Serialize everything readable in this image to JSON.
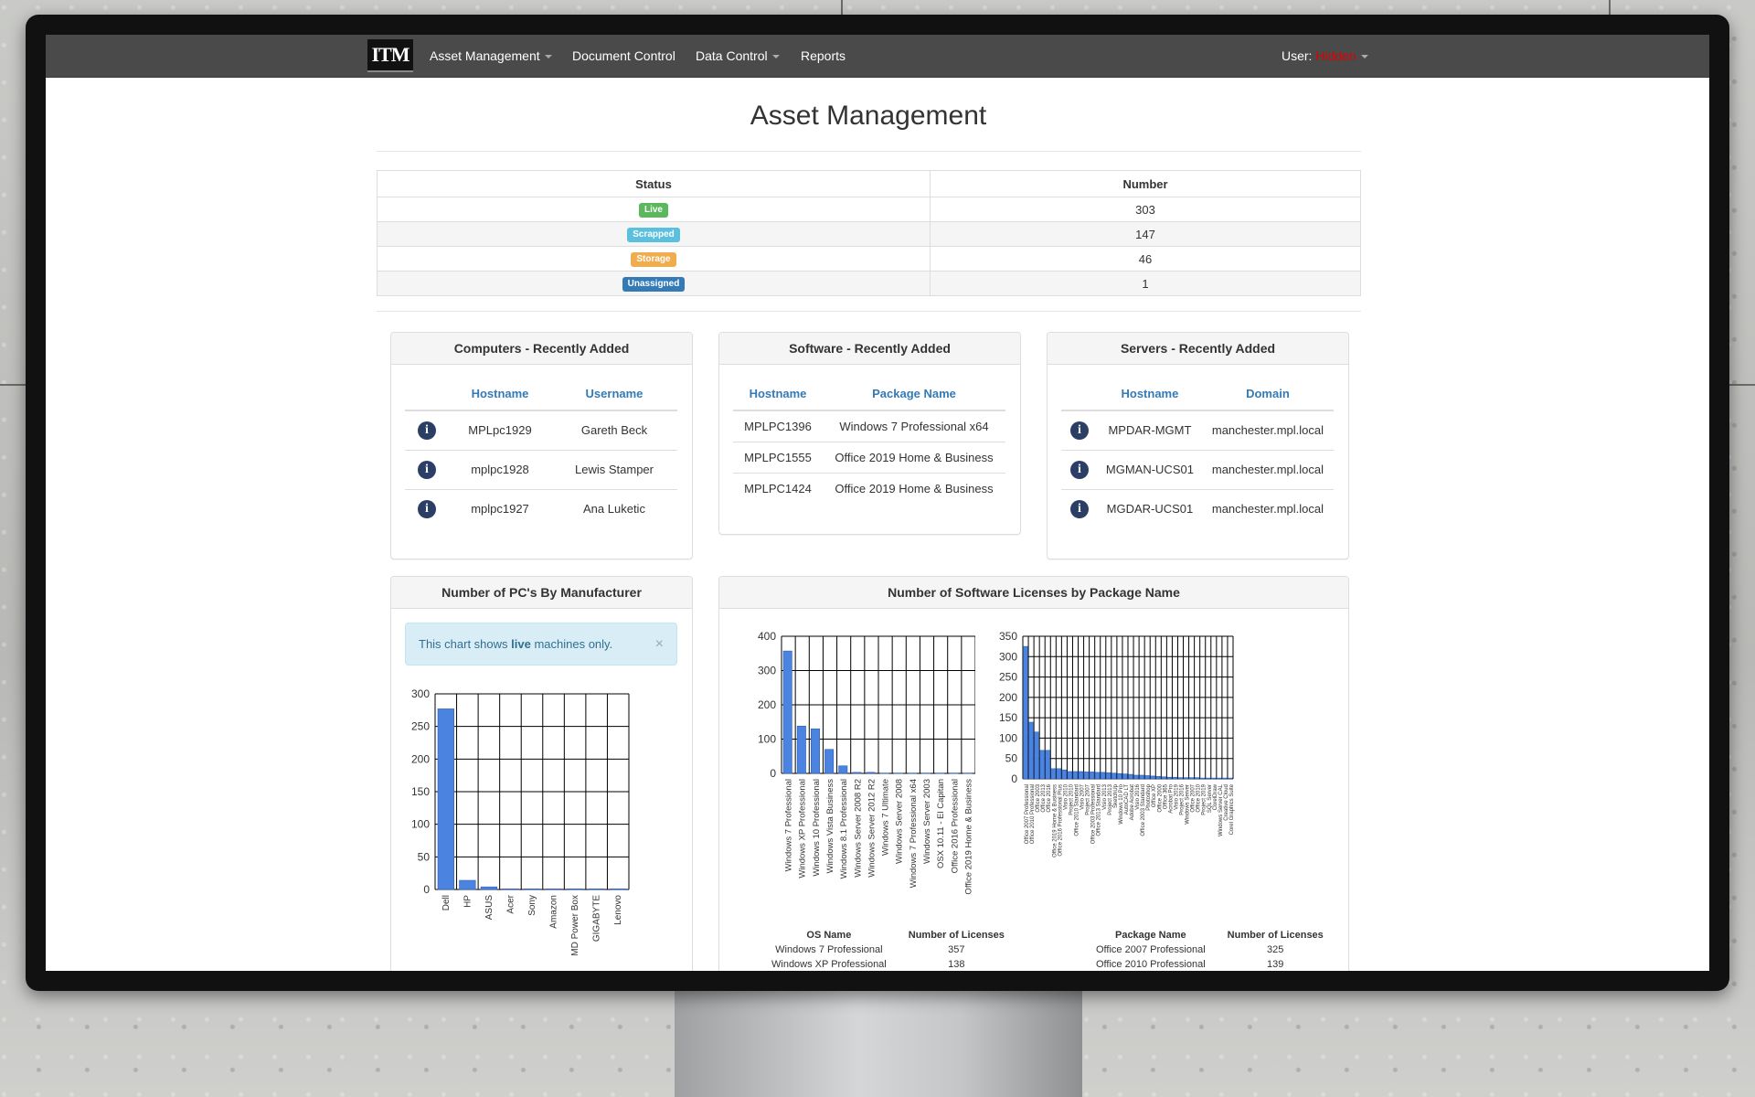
{
  "navbar": {
    "brand": "ITM",
    "items": [
      {
        "label": "Asset Management",
        "dropdown": true
      },
      {
        "label": "Document Control",
        "dropdown": false
      },
      {
        "label": "Data Control",
        "dropdown": true
      },
      {
        "label": "Reports",
        "dropdown": false
      }
    ],
    "user_label": "User:",
    "user_name": "Hidden"
  },
  "page_title": "Asset Management",
  "status_table": {
    "headers": [
      "Status",
      "Number"
    ],
    "rows": [
      {
        "status": "Live",
        "color": "#5cb85c",
        "number": "303"
      },
      {
        "status": "Scrapped",
        "color": "#5bc0de",
        "number": "147"
      },
      {
        "status": "Storage",
        "color": "#f0ad4e",
        "number": "46"
      },
      {
        "status": "Unassigned",
        "color": "#337ab7",
        "number": "1"
      }
    ]
  },
  "computers_panel": {
    "title": "Computers - Recently Added",
    "headers": [
      "Hostname",
      "Username"
    ],
    "rows": [
      {
        "hostname": "MPLpc1929",
        "username": "Gareth Beck"
      },
      {
        "hostname": "mplpc1928",
        "username": "Lewis Stamper"
      },
      {
        "hostname": "mplpc1927",
        "username": "Ana Luketic"
      }
    ]
  },
  "software_panel": {
    "title": "Software - Recently Added",
    "headers": [
      "Hostname",
      "Package Name"
    ],
    "rows": [
      {
        "hostname": "MPLPC1396",
        "package": "Windows 7 Professional x64"
      },
      {
        "hostname": "MPLPC1555",
        "package": "Office 2019 Home & Business"
      },
      {
        "hostname": "MPLPC1424",
        "package": "Office 2019 Home & Business"
      }
    ]
  },
  "servers_panel": {
    "title": "Servers - Recently Added",
    "headers": [
      "Hostname",
      "Domain"
    ],
    "rows": [
      {
        "hostname": "MPDAR-MGMT",
        "domain": "manchester.mpl.local"
      },
      {
        "hostname": "MGMAN-UCS01",
        "domain": "manchester.mpl.local"
      },
      {
        "hostname": "MGDAR-UCS01",
        "domain": "manchester.mpl.local"
      }
    ]
  },
  "manufacturer_panel": {
    "title": "Number of PC's By Manufacturer",
    "alert_prefix": "This chart shows ",
    "alert_bold": "live",
    "alert_suffix": " machines only.",
    "alert_close": "×"
  },
  "licenses_panel": {
    "title": "Number of Software Licenses by Package Name",
    "os_table": {
      "headers": [
        "OS Name",
        "Number of Licenses"
      ],
      "rows": [
        {
          "name": "Windows 7 Professional",
          "count": "357"
        },
        {
          "name": "Windows XP Professional",
          "count": "138"
        }
      ]
    },
    "package_table": {
      "headers": [
        "Package Name",
        "Number of Licenses"
      ],
      "rows": [
        {
          "name": "Office 2007 Professional",
          "count": "325"
        },
        {
          "name": "Office 2010 Professional",
          "count": "139"
        }
      ]
    }
  },
  "chart_data": [
    {
      "type": "bar",
      "categories": [
        "Dell",
        "HP",
        "ASUS",
        "Acer",
        "Sony",
        "Amazon",
        "MD Power Box",
        "GIGABYTE",
        "Lenovo"
      ],
      "values": [
        277,
        14,
        4,
        1,
        1,
        1,
        1,
        1,
        1
      ],
      "ylim": [
        0,
        300
      ],
      "yticks": [
        0,
        50,
        100,
        150,
        200,
        250,
        300
      ],
      "grid": true,
      "color": "#4b83e0"
    },
    {
      "type": "bar",
      "categories": [
        "Windows 7 Professional",
        "Windows XP Professional",
        "Windows 10 Professional",
        "Windows Vista Business",
        "Windows 8.1 Professional",
        "Windows Server 2008 R2",
        "Windows Server 2012 R2",
        "Windows 7 Ultimate",
        "Windows Server 2008",
        "Windows 7 Professional x64",
        "Windows Server 2003",
        "OSX 10.11 - El Capitan",
        "Office 2016 Professional",
        "Office 2019 Home & Business"
      ],
      "values": [
        357,
        138,
        130,
        70,
        22,
        3,
        3,
        1,
        1,
        1,
        1,
        1,
        1,
        1
      ],
      "ylim": [
        0,
        400
      ],
      "yticks": [
        0,
        100,
        200,
        300,
        400
      ],
      "grid": true,
      "color": "#4b83e0"
    },
    {
      "type": "bar",
      "categories": [
        "Office 2007 Professional",
        "Office 2010 Professional",
        "Office 2003",
        "Office 2013",
        "Office 2016",
        "Office 2019 Home & Business",
        "Office 2016 Professional Plus",
        "Visio 2010",
        "Project 2010",
        "Office 2010 Standard",
        "Visio 2007",
        "Project 2007",
        "Office 2003 Professional",
        "Office 2013 Standard",
        "Visio 2013",
        "Project 2013",
        "SketchUp",
        "Windows 10 Pro",
        "AutoCAD LT",
        "Adobe Acrobat",
        "Visio 2016",
        "Office 2003 Standard",
        "Photoshop",
        "Office XP",
        "Office 2000",
        "Office 365",
        "Acrobat Pro",
        "Visio 2019",
        "Project 2016",
        "Windows Server",
        "Office 2007",
        "Office 2010",
        "Project 2019",
        "SQL Server",
        "CorelDraw",
        "Windows Server CAL",
        "Creative Cloud",
        "Corel Graphics Suite"
      ],
      "values": [
        325,
        139,
        115,
        70,
        70,
        25,
        25,
        22,
        18,
        18,
        18,
        17,
        17,
        16,
        16,
        15,
        14,
        13,
        12,
        11,
        9,
        9,
        8,
        7,
        6,
        5,
        4,
        4,
        3,
        3,
        3,
        3,
        2,
        2,
        2,
        2,
        2,
        2
      ],
      "ylim": [
        0,
        350
      ],
      "yticks": [
        0,
        50,
        100,
        150,
        200,
        250,
        300,
        350
      ],
      "grid": true,
      "color": "#4b83e0"
    }
  ]
}
